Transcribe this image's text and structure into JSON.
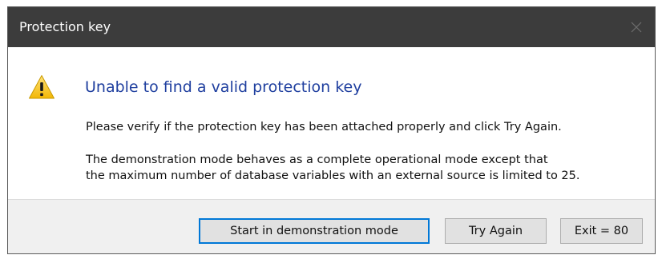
{
  "window": {
    "title": "Protection key",
    "close_icon": "close-icon"
  },
  "message": {
    "icon": "warning-icon",
    "headline": "Unable to find a valid protection key",
    "line1": "Please verify if the protection key has been attached properly and click Try Again.",
    "line2": "The demonstration mode behaves as a complete operational mode except that",
    "line3": "the maximum number of database variables with an external source is limited to 25."
  },
  "buttons": {
    "demo": "Start in demonstration mode",
    "try_again": "Try Again",
    "exit": "Exit = 80"
  },
  "colors": {
    "titlebar": "#3c3c3c",
    "headline": "#1f3f9f",
    "focus_border": "#0078d7",
    "footer": "#f0f0f0"
  }
}
